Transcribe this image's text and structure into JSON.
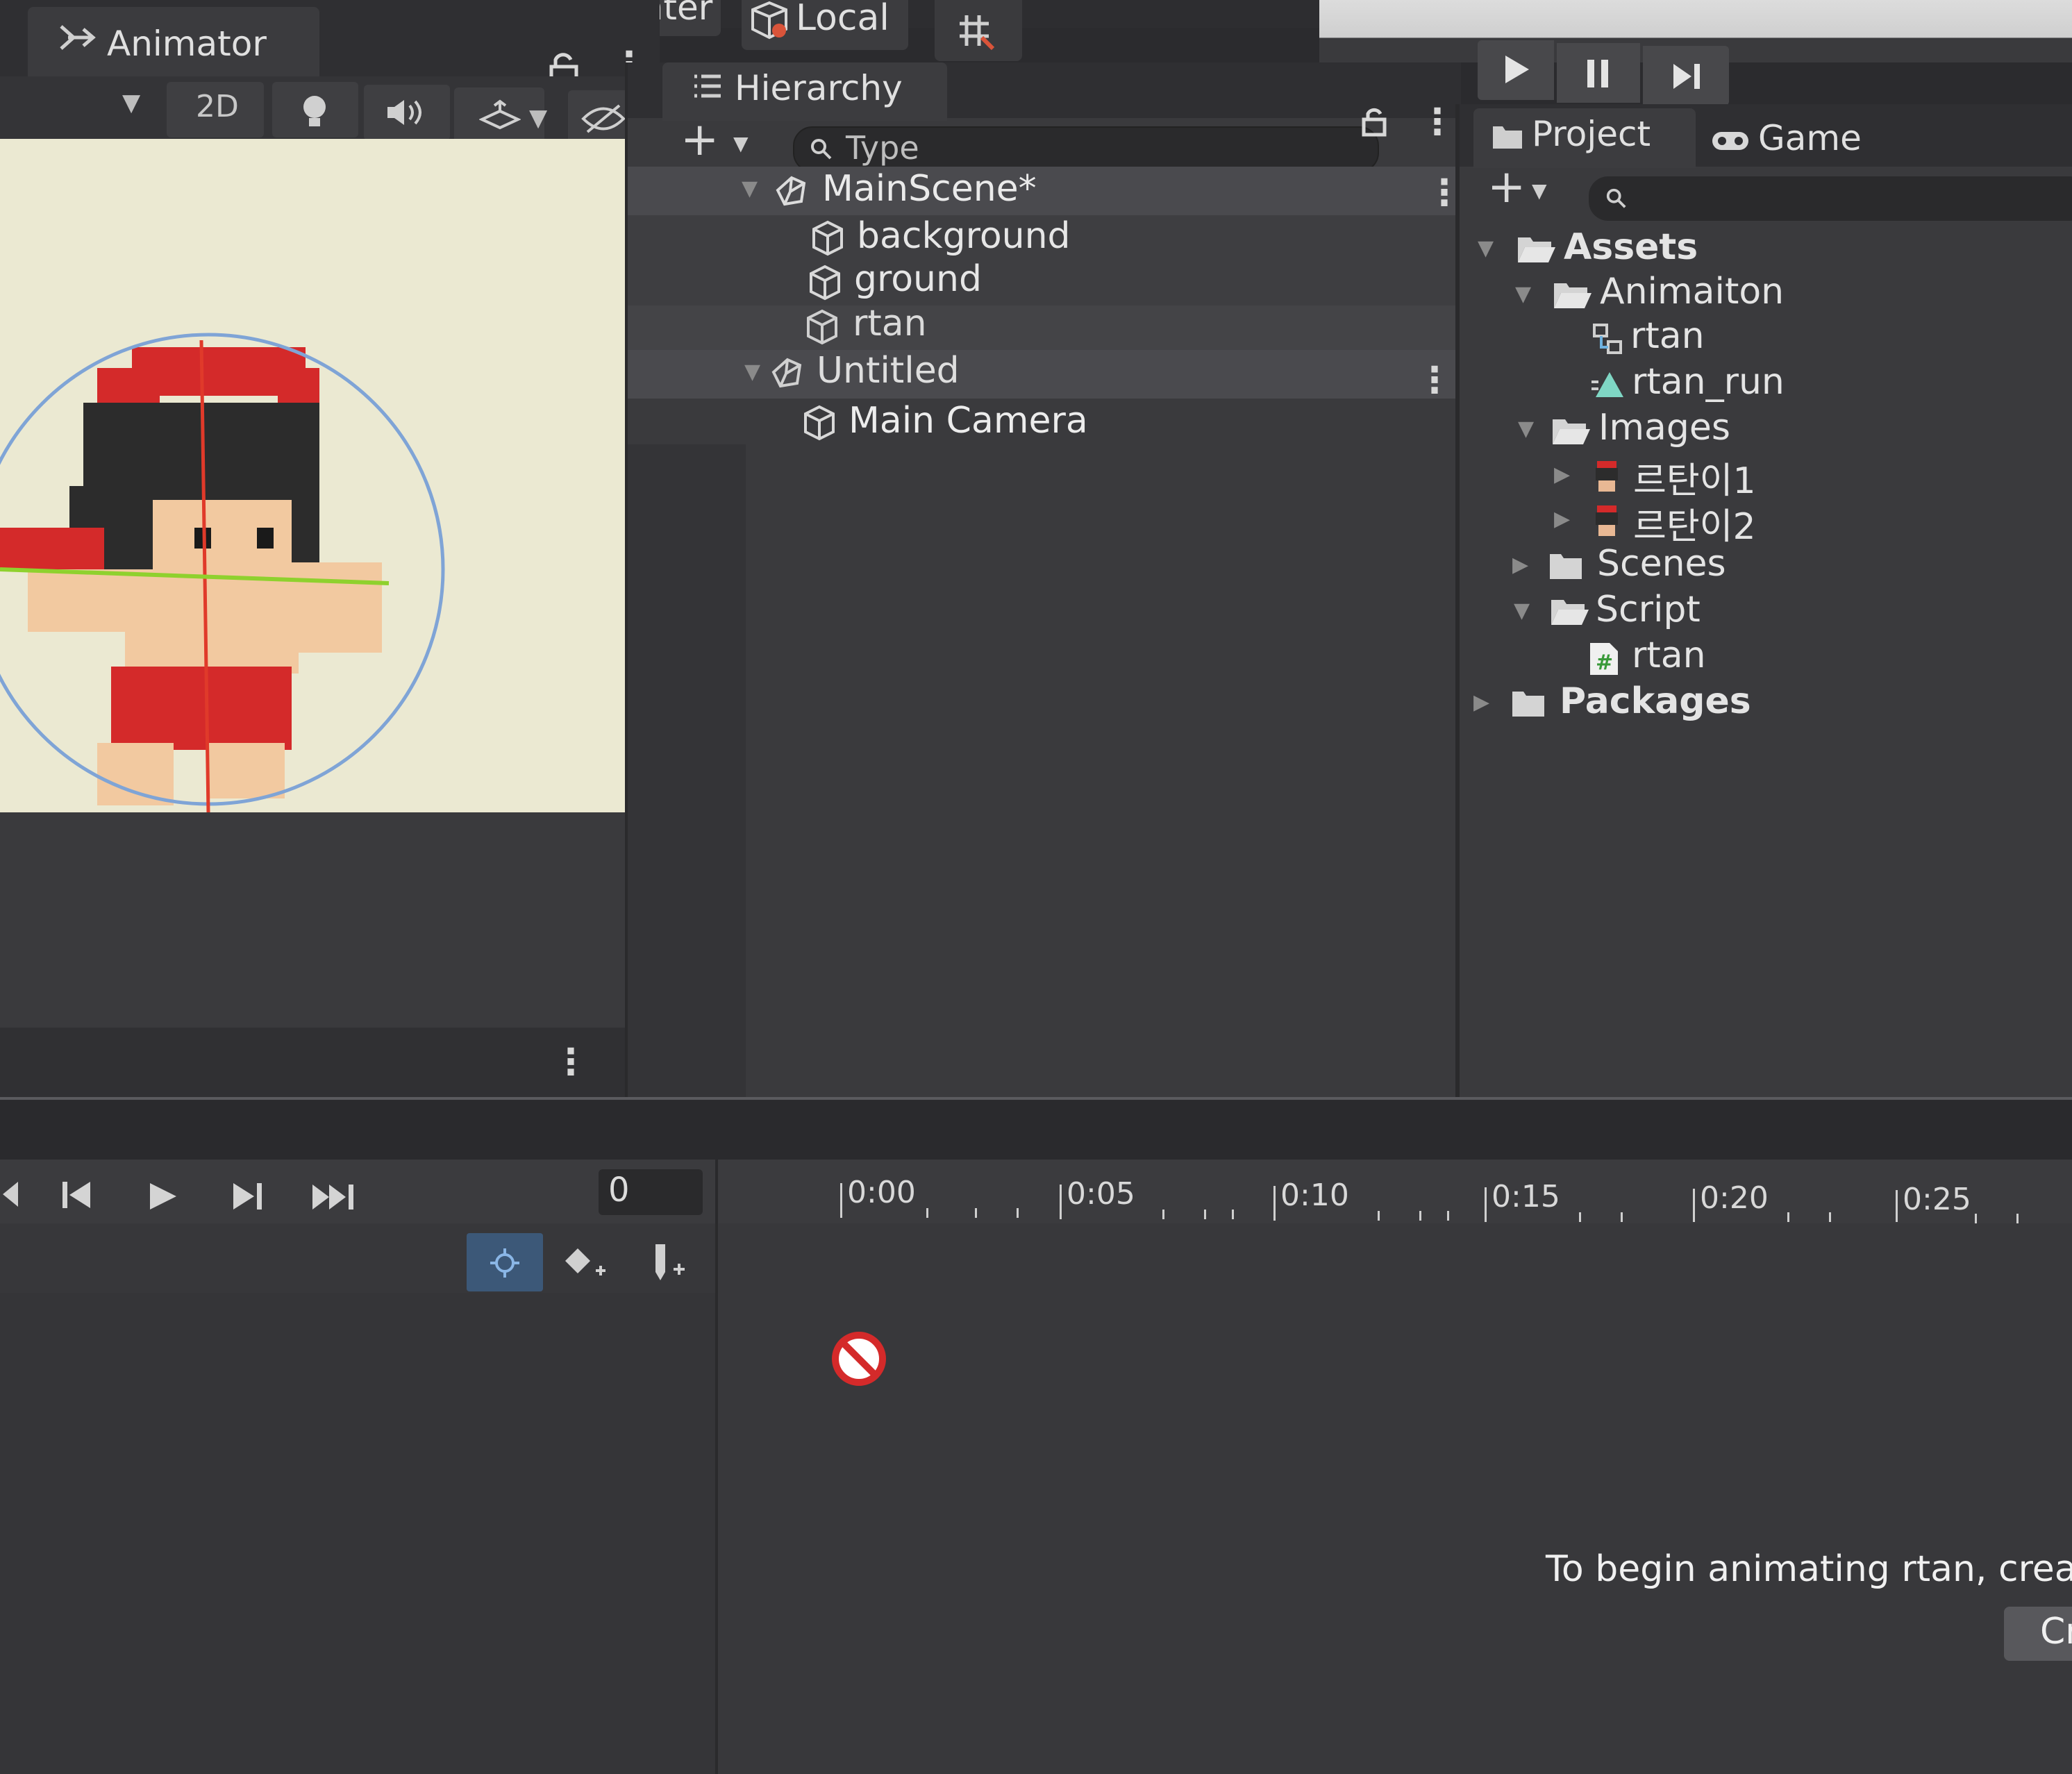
{
  "toolbar": {
    "center_label": "Center",
    "local_label": "Local"
  },
  "animator": {
    "tab_label": "Animator",
    "mode_2d": "2D",
    "hidden_count": "0"
  },
  "hierarchy": {
    "tab_label": "Hierarchy",
    "search_placeholder": "Type",
    "items": [
      {
        "label": "MainScene*",
        "kind": "scene"
      },
      {
        "label": "background",
        "kind": "object"
      },
      {
        "label": "ground",
        "kind": "object"
      },
      {
        "label": "rtan",
        "kind": "object"
      },
      {
        "label": "Untitled",
        "kind": "scene"
      },
      {
        "label": "Main Camera",
        "kind": "object"
      }
    ]
  },
  "project": {
    "tab_label": "Project",
    "game_tab_label": "Game",
    "tree": [
      {
        "label": "Assets"
      },
      {
        "label": "Animaiton"
      },
      {
        "label": "rtan"
      },
      {
        "label": "rtan_run"
      },
      {
        "label": "Images"
      },
      {
        "label": "르탄이1"
      },
      {
        "label": "르탄이2"
      },
      {
        "label": "Scenes"
      },
      {
        "label": "Script"
      },
      {
        "label": "rtan"
      },
      {
        "label": "Packages"
      }
    ]
  },
  "animation": {
    "frame_value": "0",
    "timeline_ticks": [
      "0:00",
      "0:05",
      "0:10",
      "0:15",
      "0:20",
      "0:25"
    ],
    "message": "To begin animating rtan, create",
    "create_button_label": "Cr"
  },
  "colors": {
    "scene_bg": "#ebe9d2",
    "panel_bg": "#373739",
    "accent_red": "#d42a2a",
    "selection_blue": "#3a5a86"
  }
}
